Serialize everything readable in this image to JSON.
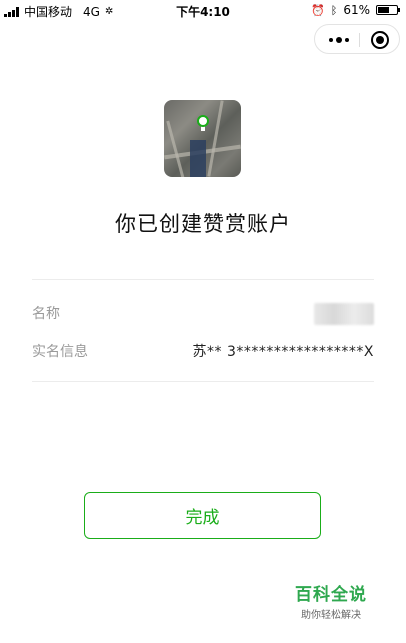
{
  "status_bar": {
    "carrier": "中国移动",
    "network": "4G",
    "time": "下午4:10",
    "battery_percent": "61%"
  },
  "capsule": {
    "more_icon": "more-dots-icon",
    "close_icon": "target-close-icon"
  },
  "page": {
    "headline": "你已创建赞赏账户"
  },
  "info": {
    "name_label": "名称",
    "realname_label": "实名信息",
    "realname_value": "苏** 3*****************X"
  },
  "actions": {
    "done_label": "完成"
  },
  "watermark": {
    "title": "百科全说",
    "subtitle": "助你轻松解决"
  },
  "colors": {
    "accent": "#1aad19"
  }
}
